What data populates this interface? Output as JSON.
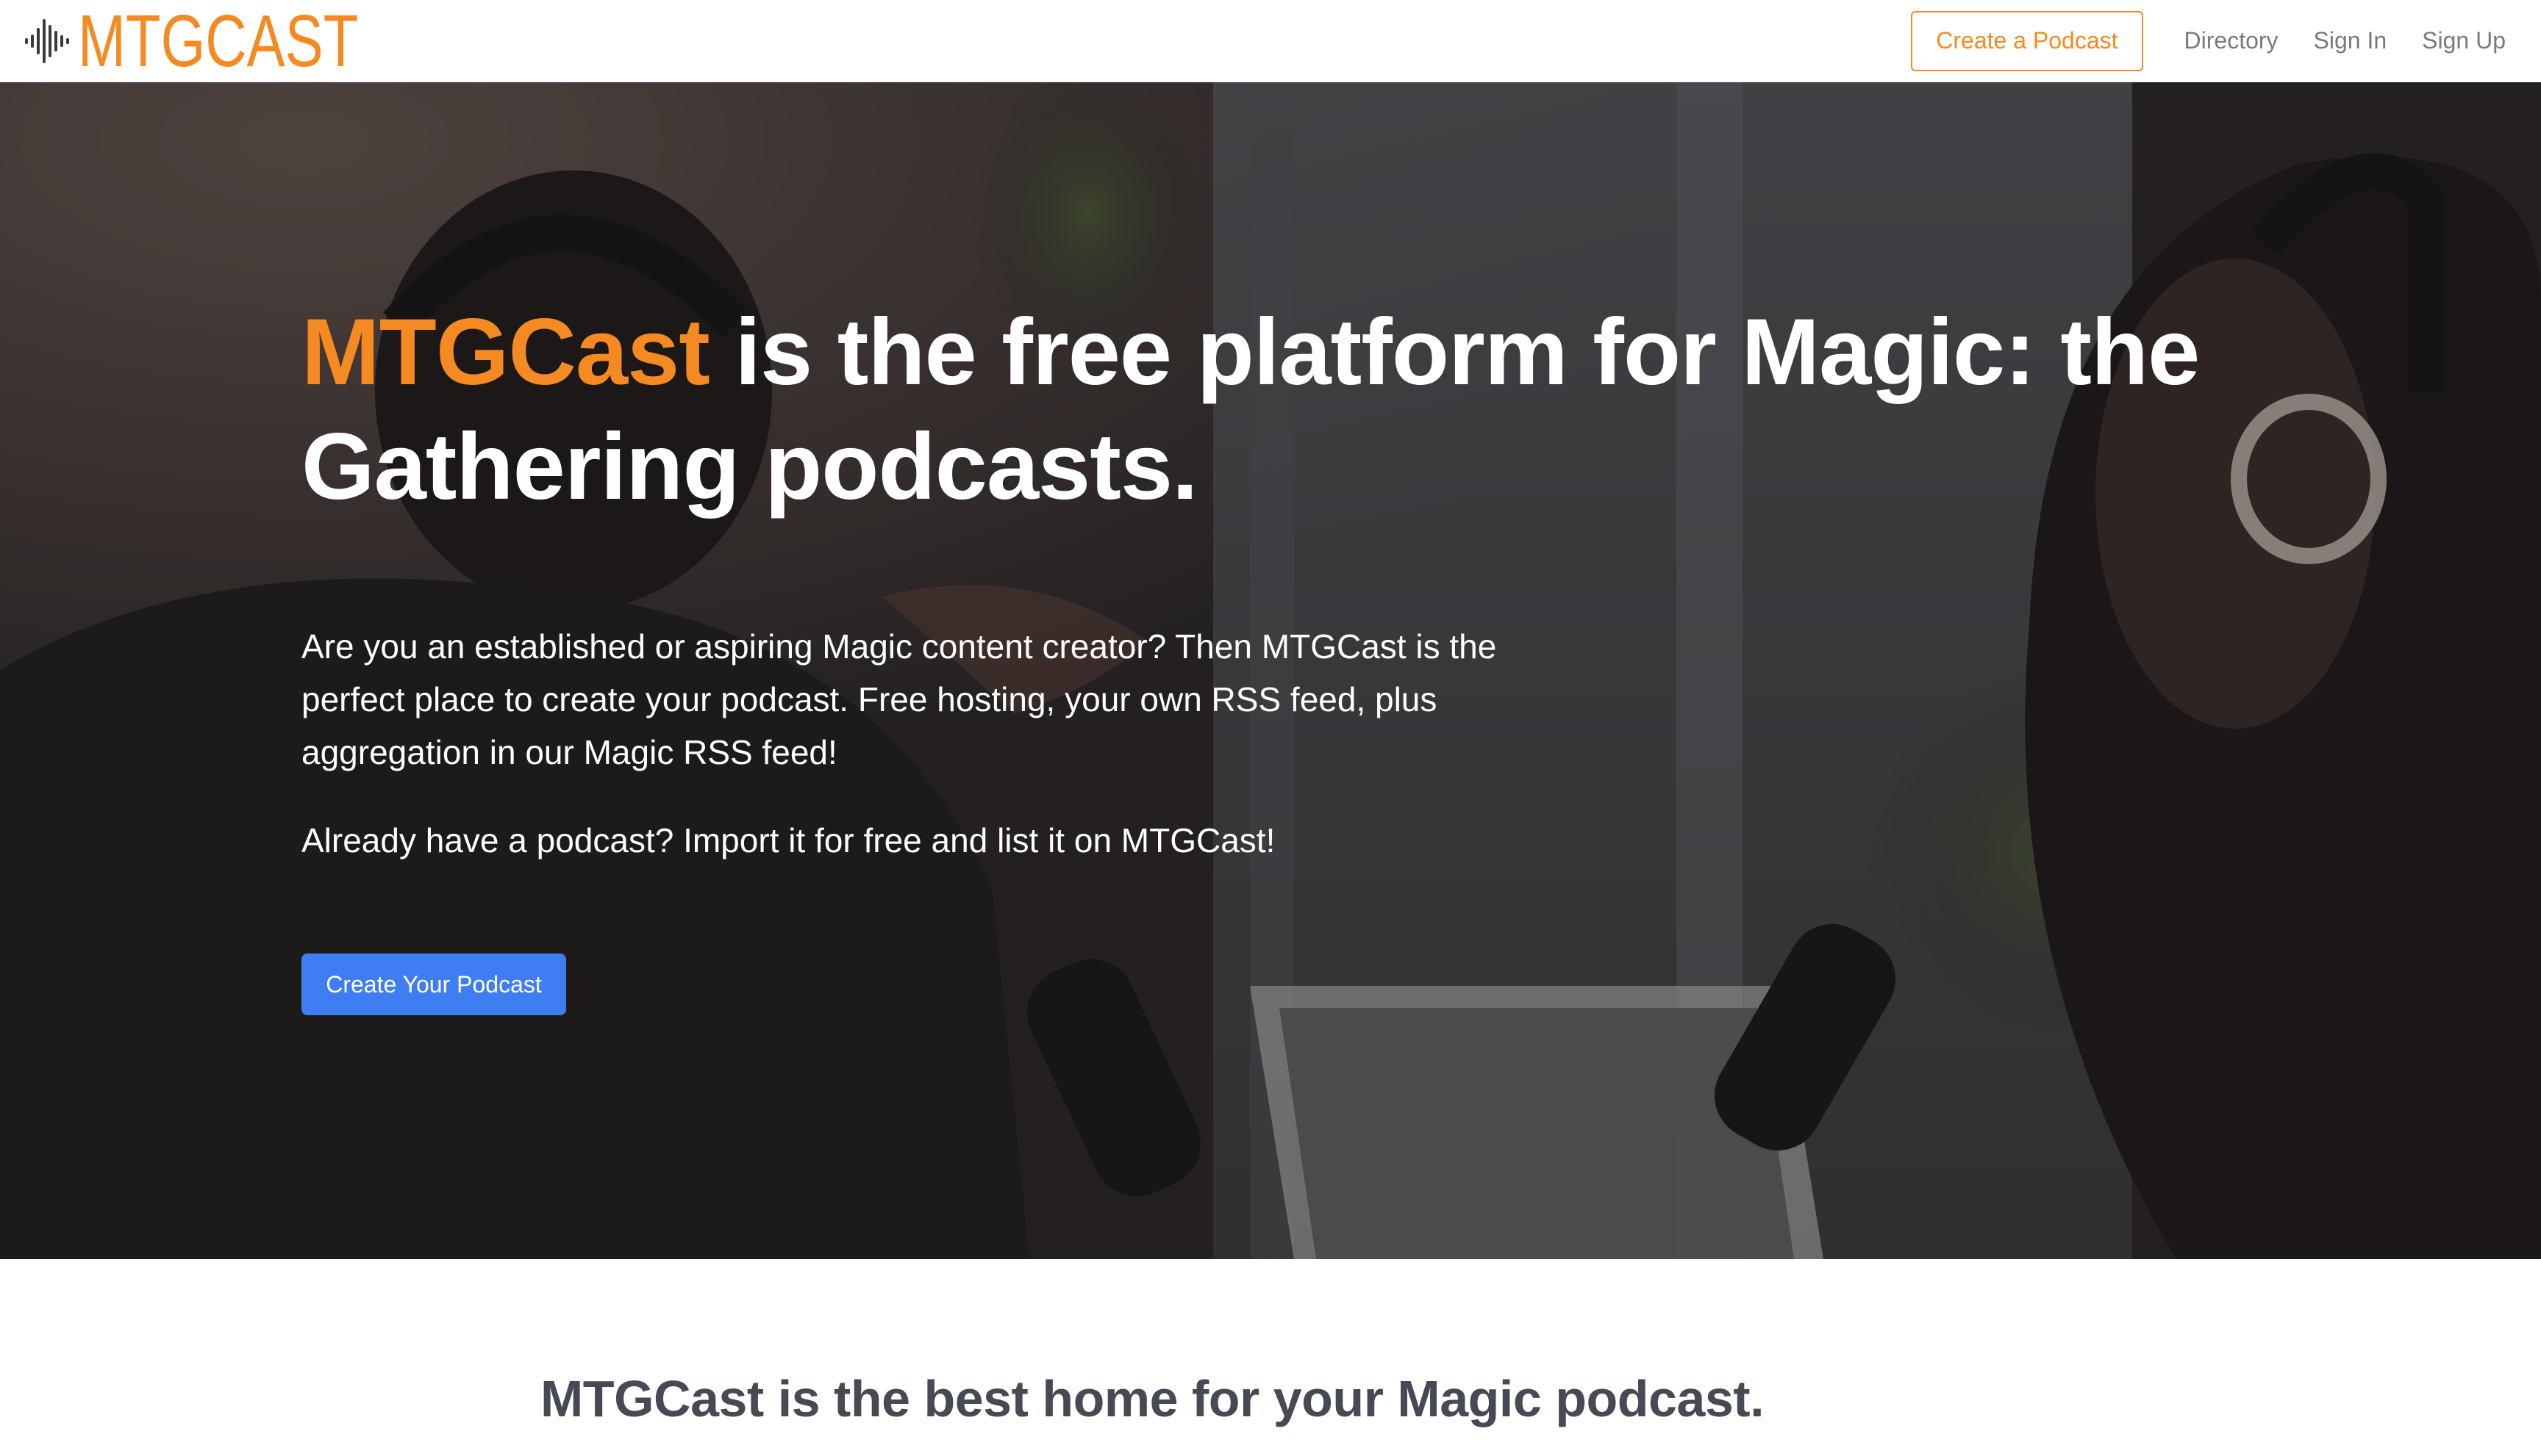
{
  "brand": {
    "logo_text": "MTGCAST"
  },
  "nav": {
    "cta_label": "Create a Podcast",
    "links": [
      "Directory",
      "Sign In",
      "Sign Up"
    ]
  },
  "hero": {
    "title_accent": "MTGCast",
    "title_rest": " is the free platform for Magic: the Gathering podcasts.",
    "paragraph_1": "Are you an established or aspiring Magic content creator? Then MTGCast is the perfect place to create your podcast. Free hosting, your own RSS feed, plus aggregation in our Magic RSS feed!",
    "paragraph_2": "Already have a podcast? Import it for free and list it on MTGCast!",
    "button_label": "Create Your Podcast",
    "background_description_icon": "podcast-hosts-photo"
  },
  "section2": {
    "title": "MTGCast is the best home for your Magic podcast."
  },
  "colors": {
    "accent": "#f48a21",
    "button_blue": "#3f7ef2",
    "nav_text": "#7a7a7a",
    "section_heading": "#464a55"
  }
}
